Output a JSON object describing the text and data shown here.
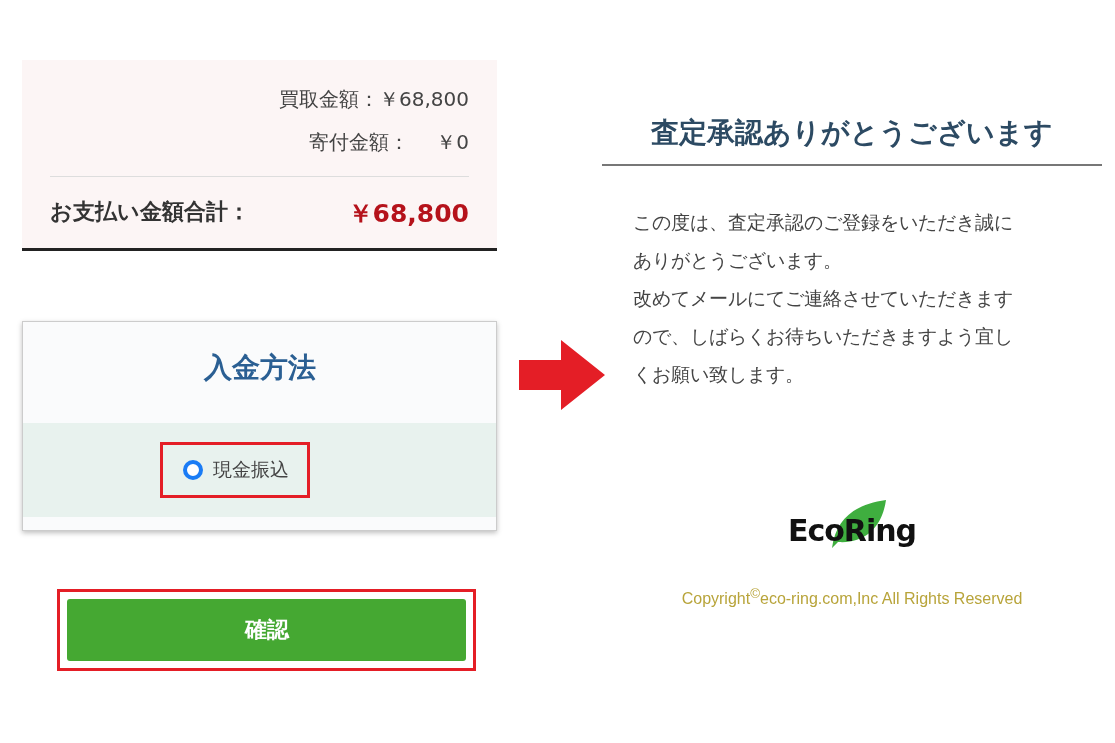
{
  "summary": {
    "rows": [
      {
        "label": "買取金額：",
        "value": "￥68,800"
      },
      {
        "label": "寄付金額：",
        "value": "￥0"
      }
    ],
    "total": {
      "label": "お支払い金額合計：",
      "value": "￥68,800"
    }
  },
  "payment_method": {
    "title": "入金方法",
    "options": [
      {
        "label": "現金振込",
        "selected": true,
        "highlighted": true
      }
    ]
  },
  "confirm_button": {
    "label": "確認",
    "highlighted": true
  },
  "thanks": {
    "title": "査定承認ありがとうございます",
    "message_lines": [
      "この度は、査定承認のご登録をいただき誠に",
      "ありがとうございます。",
      "改めてメールにてご連絡させていただきます",
      "ので、しばらくお待ちいただきますよう宜し",
      "くお願い致します。"
    ],
    "logo": "EcoRing",
    "copyright": "Copyright$^{©}$eco-ring.com,Inc All Rights Reserved"
  }
}
